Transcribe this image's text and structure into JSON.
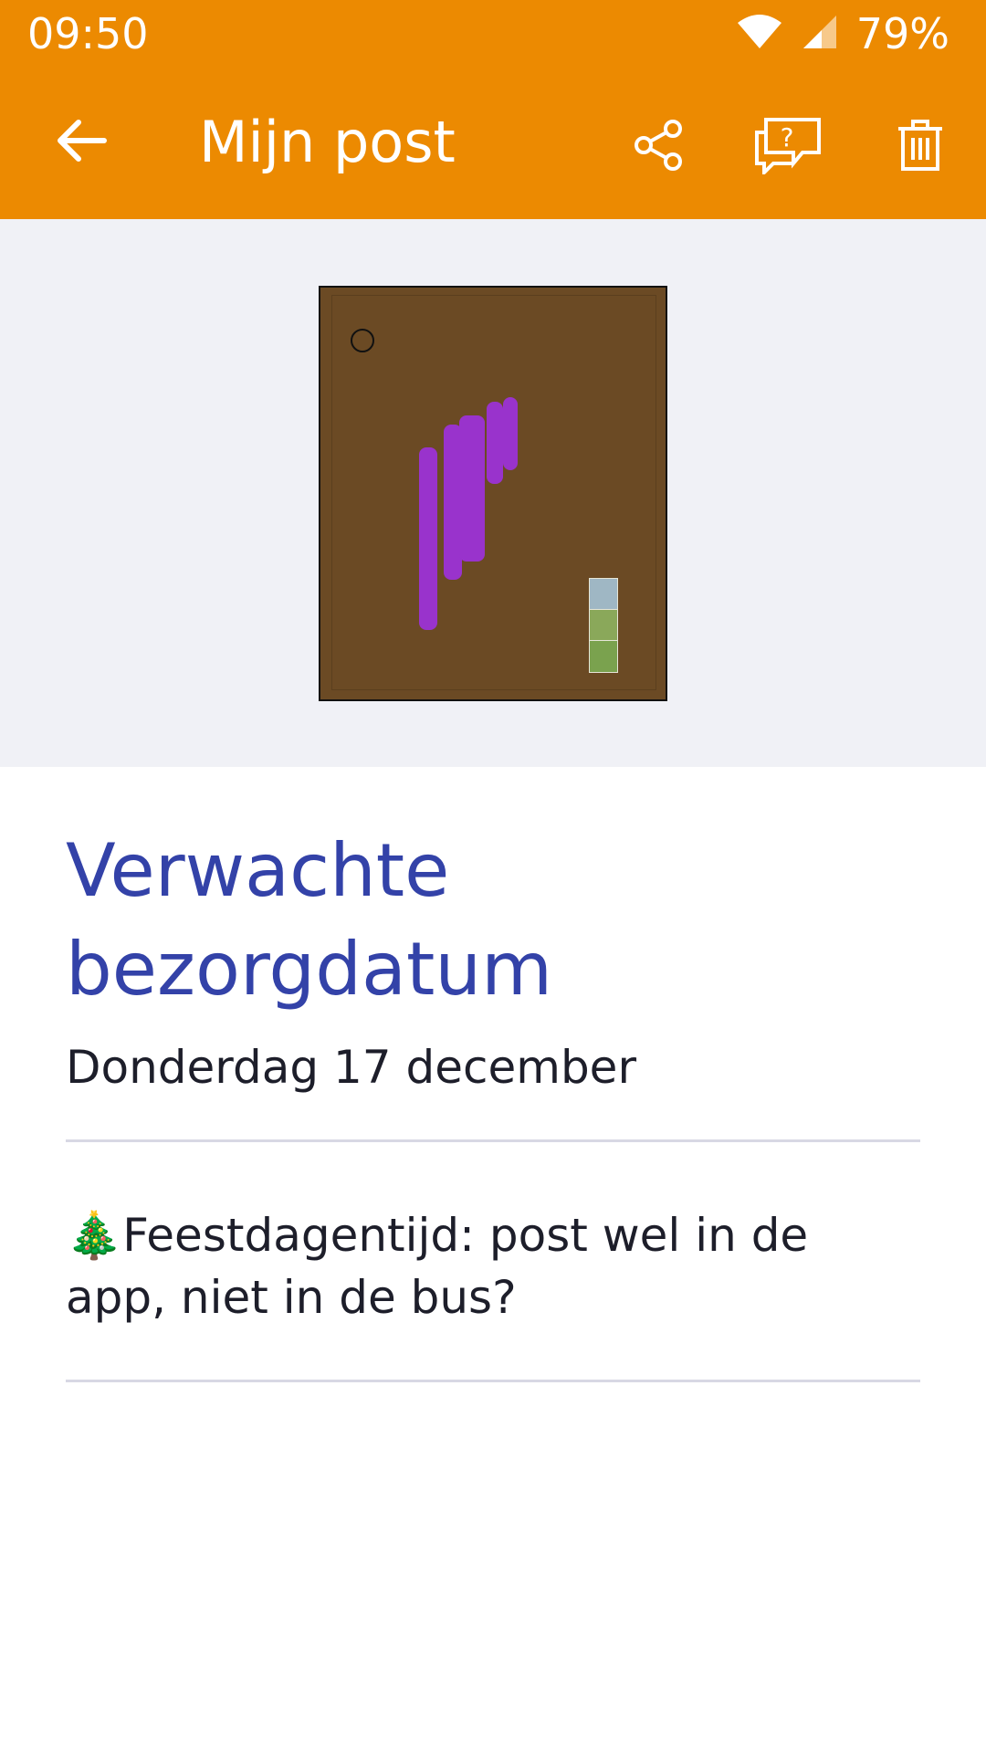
{
  "status_bar": {
    "time": "09:50",
    "battery": "79%",
    "icons": [
      "wifi-icon",
      "signal-icon"
    ]
  },
  "app_bar": {
    "title": "Mijn post",
    "back_icon": "arrow-left-icon",
    "actions": [
      "share-icon",
      "help-chat-icon",
      "trash-icon"
    ]
  },
  "mail_item": {
    "image_description_icon": "envelope-scan-image"
  },
  "delivery": {
    "heading": "Verwachte bezorgdatum",
    "date": "Donderdag 17 december"
  },
  "holiday_notice": {
    "emoji": "🎄",
    "text": "Feestdagentijd: post wel in de app, niet in de bus?"
  },
  "colors": {
    "brand_orange": "#ec8a01",
    "heading_blue": "#3342a8",
    "image_bg": "#f0f1f6"
  }
}
